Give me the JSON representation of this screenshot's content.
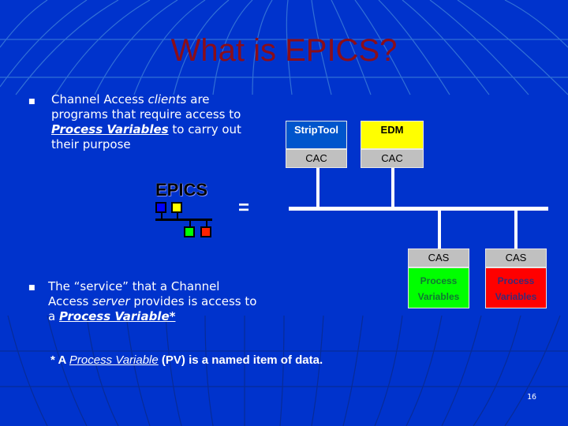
{
  "slide": {
    "title": "What is EPICS?",
    "page_number": "16",
    "colors": {
      "background": "#0033cc",
      "title": "#8b0d1a",
      "striptool_box": "#0055cc",
      "edm_box": "#ffff00",
      "cas_label_box": "#c0c0c0",
      "pv_green": "#00ff00",
      "pv_red": "#ff0000"
    }
  },
  "bullets": [
    {
      "icon": "square-bullet-icon",
      "parts": [
        "Channel Access ",
        "clients",
        " are programs that require access to ",
        "Process Variables",
        " to carry out their purpose"
      ]
    },
    {
      "icon": "square-bullet-icon",
      "parts": [
        "The “service” that a Channel Access ",
        "server",
        " provides is access to a ",
        "Process Variable*"
      ]
    }
  ],
  "diagram": {
    "clients": [
      {
        "name": "StripTool",
        "layer": "CAC"
      },
      {
        "name": "EDM",
        "layer": "CAC"
      }
    ],
    "servers": [
      {
        "layer": "CAS",
        "line1": "Process",
        "line2": "Variables"
      },
      {
        "layer": "CAS",
        "line1": "Process",
        "line2": "Variables"
      }
    ],
    "logo_text": "EPICS",
    "equals": "="
  },
  "footnote": {
    "prefix": "* A ",
    "term": "Process Variable",
    "suffix": " (PV) is a named item of data."
  }
}
